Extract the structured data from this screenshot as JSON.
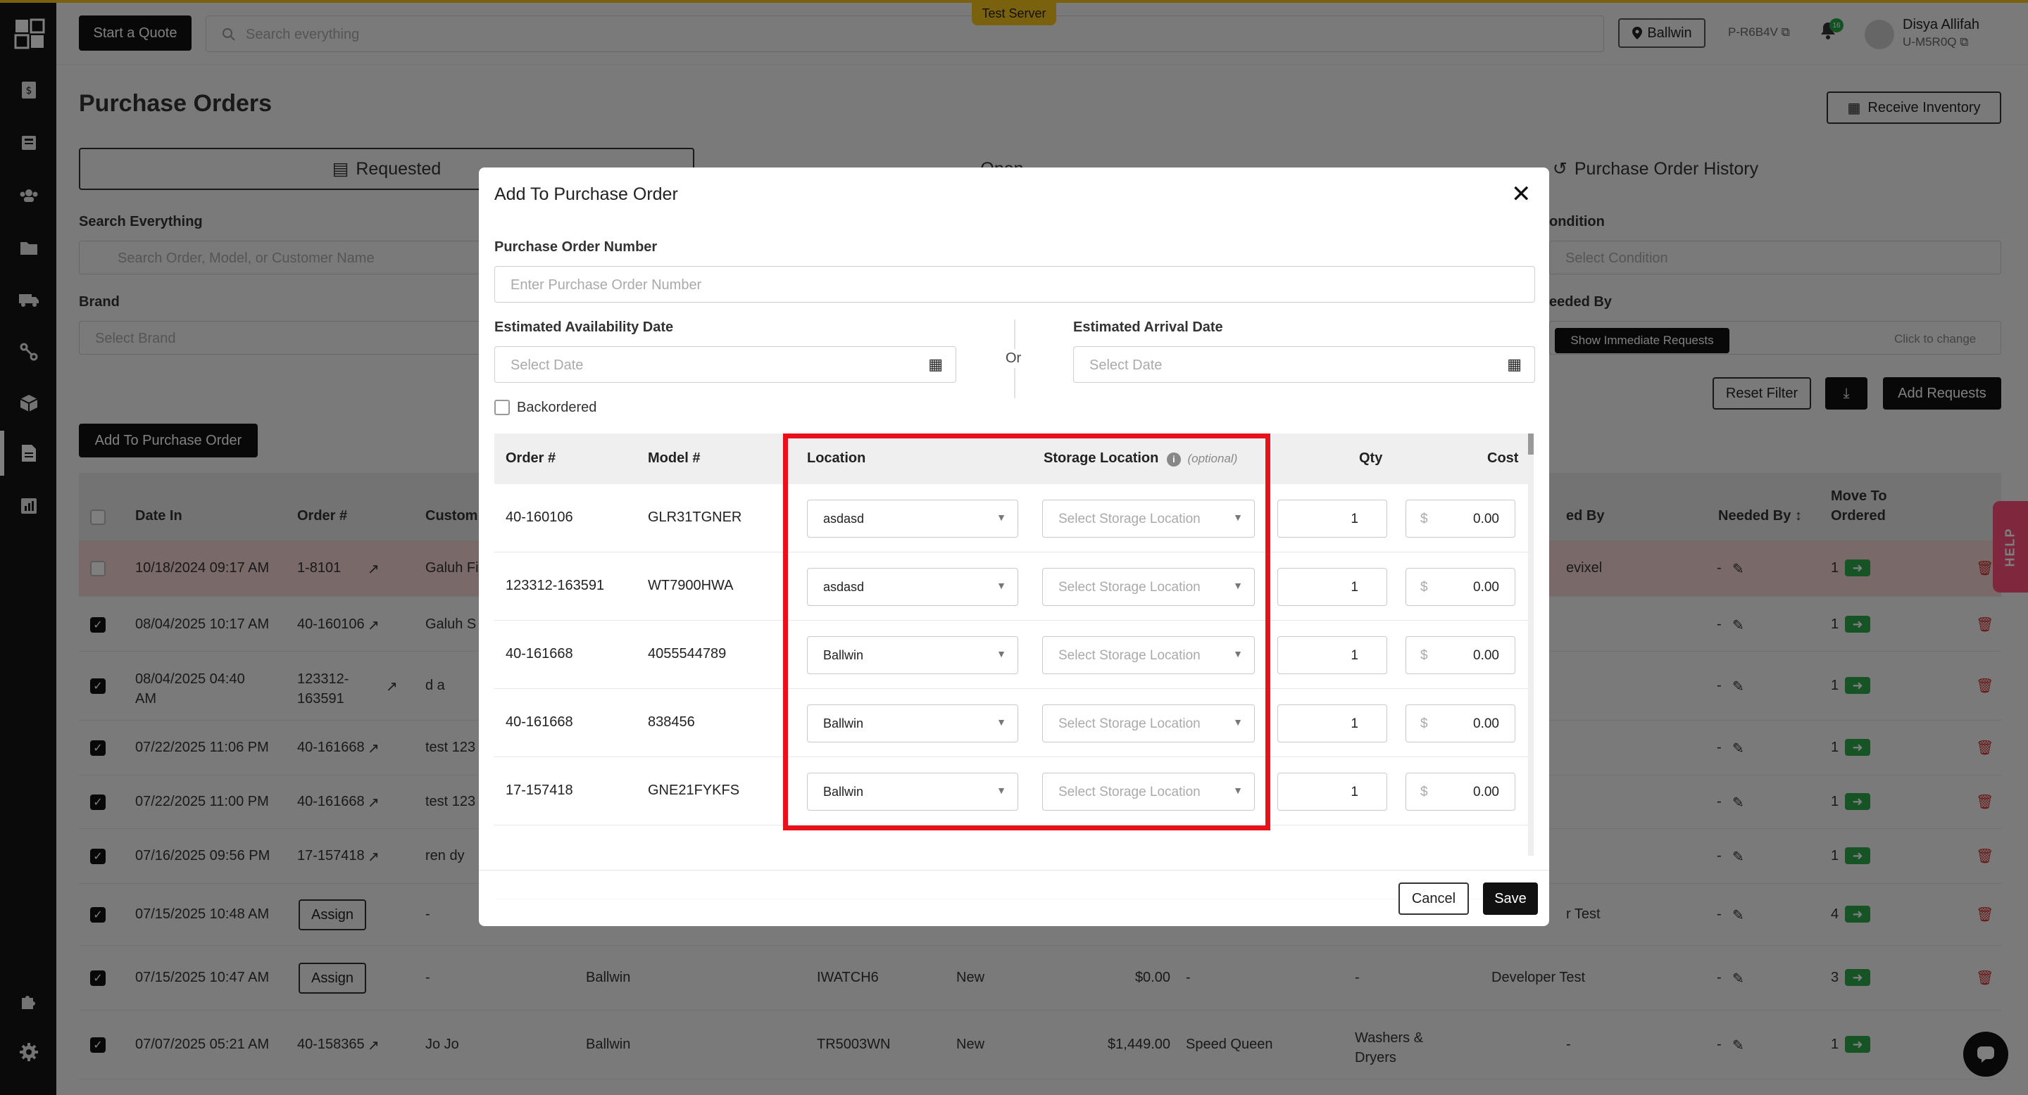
{
  "server_badge": "Test Server",
  "header": {
    "start_quote": "Start a Quote",
    "search_placeholder": "Search everything",
    "location": "Ballwin",
    "p_code": "P-R6B4V",
    "notif_count": "16",
    "user_name": "Disya Allifah",
    "user_code": "U-M5R0Q"
  },
  "page": {
    "title": "Purchase Orders",
    "receive_inventory": "Receive Inventory",
    "tabs": [
      "Requested",
      "Open",
      "Purchase Order History"
    ]
  },
  "filters": {
    "search_label": "Search Everything",
    "search_placeholder": "Search Order, Model, or Customer Name",
    "brand_label": "Brand",
    "brand_placeholder": "Select Brand",
    "condition_label": "ondition",
    "condition_placeholder": "Select Condition",
    "needed_by_label": "eeded By",
    "show_immediate": "Show Immediate Requests",
    "click_to_change": "Click to change",
    "reset_filter": "Reset Filter",
    "add_requests": "Add Requests",
    "add_to_po": "Add To Purchase Order"
  },
  "table": {
    "headers": {
      "date_in": "Date In",
      "order": "Order #",
      "customer": "Custom",
      "requested_by": "ed By",
      "needed_by": "Needed By",
      "move_to_ordered_1": "Move To",
      "move_to_ordered_2": "Ordered"
    },
    "rows": [
      {
        "date": "10/18/2024 09:17 AM",
        "order": "1-8101",
        "customer": "Galuh Fi",
        "requested_by": "evixel",
        "needed": "-",
        "move": "1"
      },
      {
        "date": "08/04/2025 10:17 AM",
        "order": "40-160106",
        "customer": "Galuh S",
        "requested_by": "",
        "needed": "-",
        "move": "1"
      },
      {
        "date": "08/04/2025 04:40 AM",
        "order": "123312-163591",
        "customer": "d a",
        "requested_by": "",
        "needed": "-",
        "move": "1"
      },
      {
        "date": "07/22/2025 11:06 PM",
        "order": "40-161668",
        "customer": "test 123",
        "requested_by": "",
        "needed": "-",
        "move": "1"
      },
      {
        "date": "07/22/2025 11:00 PM",
        "order": "40-161668",
        "customer": "test 123",
        "requested_by": "",
        "needed": "-",
        "move": "1"
      },
      {
        "date": "07/16/2025 09:56 PM",
        "order": "17-157418",
        "customer": "ren dy",
        "requested_by": "",
        "needed": "-",
        "move": "1"
      },
      {
        "date": "07/15/2025 10:48 AM",
        "order": "Assign",
        "customer": "-",
        "requested_by": "r Test",
        "needed": "-",
        "move": "4"
      },
      {
        "date": "07/15/2025 10:47 AM",
        "order": "Assign",
        "customer": "-",
        "location": "Ballwin",
        "model": "IWATCH6",
        "condition": "New",
        "cost": "$0.00",
        "brand": "-",
        "category": "-",
        "requested_by": "Developer Test",
        "needed": "-",
        "move": "3"
      },
      {
        "date": "07/07/2025 05:21 AM",
        "order": "40-158365",
        "customer": "Jo Jo",
        "location": "Ballwin",
        "model": "TR5003WN",
        "condition": "New",
        "cost": "$1,449.00",
        "brand": "Speed Queen",
        "category": "Washers & Dryers",
        "requested_by": "-",
        "needed": "-",
        "move": "1"
      }
    ]
  },
  "help_tab": "HELP",
  "modal": {
    "title": "Add To Purchase Order",
    "po_number_label": "Purchase Order Number",
    "po_number_placeholder": "Enter Purchase Order Number",
    "est_avail_label": "Estimated Availability Date",
    "est_arrival_label": "Estimated Arrival Date",
    "date_placeholder": "Select Date",
    "or": "Or",
    "backordered": "Backordered",
    "columns": {
      "order": "Order #",
      "model": "Model #",
      "location": "Location",
      "storage": "Storage Location",
      "optional": "(optional)",
      "qty": "Qty",
      "cost": "Cost"
    },
    "storage_placeholder": "Select Storage Location",
    "currency": "$",
    "rows": [
      {
        "order": "40-160106",
        "model": "GLR31TGNER",
        "location": "asdasd",
        "qty": "1",
        "cost": "0.00"
      },
      {
        "order": "123312-163591",
        "model": "WT7900HWA",
        "location": "asdasd",
        "qty": "1",
        "cost": "0.00"
      },
      {
        "order": "40-161668",
        "model": "4055544789",
        "location": "Ballwin",
        "qty": "1",
        "cost": "0.00"
      },
      {
        "order": "40-161668",
        "model": "838456",
        "location": "Ballwin",
        "qty": "1",
        "cost": "0.00"
      },
      {
        "order": "17-157418",
        "model": "GNE21FYKFS",
        "location": "Ballwin",
        "qty": "1",
        "cost": "0.00"
      }
    ],
    "cancel": "Cancel",
    "save": "Save"
  },
  "colors": {
    "accent": "#f5c21b",
    "highlight_frame": "#e8101a",
    "success": "#2da84a",
    "danger": "#d12d2d",
    "help": "#ff4f7b"
  }
}
